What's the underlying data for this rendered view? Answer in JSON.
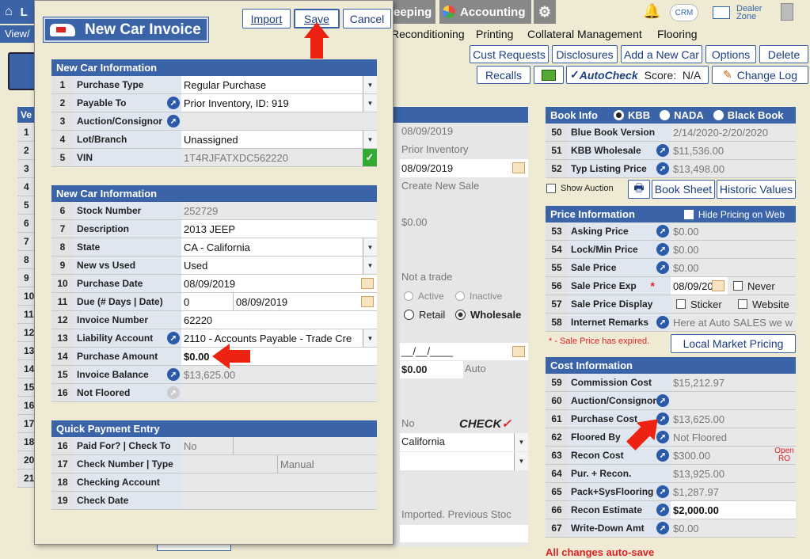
{
  "topbar": {
    "home": "L",
    "tab_keeping": "eeping",
    "tab_accounting": "Accounting",
    "crm": "CRM",
    "dealer_zone": "Dealer Zone",
    "view": "View/"
  },
  "menu": {
    "items": [
      "Reconditioning",
      "Printing",
      "Collateral Management",
      "Flooring"
    ]
  },
  "actions": {
    "row1": [
      "Cust Requests",
      "Disclosures",
      "Add a New Car",
      "Options",
      "Delete"
    ],
    "recalls": "Recalls",
    "autocheck": "AutoCheck",
    "score": "Score:  N/A",
    "change_log": "Change Log"
  },
  "dialog": {
    "title": "New Car Invoice",
    "import": "Import",
    "save": "Save",
    "cancel": "Cancel",
    "sec1": "New Car Information",
    "rows1": [
      {
        "n": "1",
        "label": "Purchase Type",
        "value": "Regular Purchase"
      },
      {
        "n": "2",
        "label": "Payable To",
        "value": "Prior Inventory,  ID: 919"
      },
      {
        "n": "3",
        "label": "Auction/Consignor",
        "value": ""
      },
      {
        "n": "4",
        "label": "Lot/Branch",
        "value": "Unassigned"
      },
      {
        "n": "5",
        "label": "VIN",
        "value": "1T4RJFATXDC562220"
      }
    ],
    "sec2": "New Car Information",
    "rows2": [
      {
        "n": "6",
        "label": "Stock Number",
        "value": "252729"
      },
      {
        "n": "7",
        "label": "Description",
        "value": "2013 JEEP"
      },
      {
        "n": "8",
        "label": "State",
        "value": "CA - California"
      },
      {
        "n": "9",
        "label": "New vs Used",
        "value": "Used"
      },
      {
        "n": "10",
        "label": "Purchase Date",
        "value": "08/09/2019"
      },
      {
        "n": "11",
        "label": "Due (# Days | Date)",
        "value": "0",
        "value2": "08/09/2019"
      },
      {
        "n": "12",
        "label": "Invoice Number",
        "value": "62220"
      },
      {
        "n": "13",
        "label": "Liability Account",
        "value": "2110 - Accounts Payable - Trade Cre"
      },
      {
        "n": "14",
        "label": "Purchase Amount",
        "value": "$0.00"
      },
      {
        "n": "15",
        "label": "Invoice Balance",
        "value": "$13,625.00"
      },
      {
        "n": "16",
        "label": "Not Floored",
        "value": ""
      }
    ],
    "sec3": "Quick Payment Entry",
    "rows3": [
      {
        "n": "16",
        "label": "Paid For? | Check To",
        "value": "No",
        "value2": ""
      },
      {
        "n": "17",
        "label": "Check Number | Type",
        "value": "",
        "value2": "Manual"
      },
      {
        "n": "18",
        "label": "Checking Account",
        "value": ""
      },
      {
        "n": "19",
        "label": "Check Date",
        "value": ""
      }
    ]
  },
  "middle": {
    "v1": "08/09/2019",
    "v2": "Prior Inventory",
    "v3": "08/09/2019",
    "v4": "Create New Sale",
    "v5": "$0.00",
    "v6": "Not a trade",
    "active": "Active",
    "inactive": "Inactive",
    "retail": "Retail",
    "wholesale": "Wholesale",
    "date_blank": "__/__/____",
    "v7": "$0.00",
    "v8": "Auto",
    "v9": "No",
    "check": "CHECK",
    "v10": "California",
    "v11": "Imported.  Previous Stoc",
    "left_nums": [
      "1",
      "2",
      "3",
      "4",
      "5",
      "6",
      "7",
      "8",
      "9",
      "10",
      "11",
      "12",
      "13",
      "14",
      "15",
      "16",
      "17",
      "18",
      "20",
      "21"
    ],
    "left_hdr": "Ve"
  },
  "book": {
    "title": "Book Info",
    "kbb": "KBB",
    "nada": "NADA",
    "black": "Black Book",
    "rows": [
      {
        "n": "50",
        "label": "Blue Book Version",
        "value": "2/14/2020-2/20/2020"
      },
      {
        "n": "51",
        "label": "KBB Wholesale",
        "value": "$11,536.00"
      },
      {
        "n": "52",
        "label": "Typ Listing Price",
        "value": "$13,498.00"
      }
    ],
    "show_auction": "Show Auction",
    "book_sheet": "Book Sheet",
    "historic": "Historic Values"
  },
  "price": {
    "title": "Price Information",
    "hide": "Hide Pricing on Web",
    "rows": [
      {
        "n": "53",
        "label": "Asking Price",
        "value": "$0.00"
      },
      {
        "n": "54",
        "label": "Lock/Min Price",
        "value": "$0.00"
      },
      {
        "n": "55",
        "label": "Sale Price",
        "value": "$0.00"
      },
      {
        "n": "56",
        "label": "Sale Price Exp",
        "value": "08/09/2019",
        "extra": "Never"
      },
      {
        "n": "57",
        "label": "Sale Price Display",
        "value": "Sticker",
        "extra": "Website"
      },
      {
        "n": "58",
        "label": "Internet Remarks",
        "value": "Here at Auto SALES we w"
      }
    ],
    "expired": "* - Sale Price has expired.",
    "local": "Local Market Pricing"
  },
  "cost": {
    "title": "Cost Information",
    "rows": [
      {
        "n": "59",
        "label": "Commission Cost",
        "value": "$15,212.97"
      },
      {
        "n": "60",
        "label": "Auction/Consignor",
        "value": ""
      },
      {
        "n": "61",
        "label": "Purchase Cost",
        "value": "$13,625.00"
      },
      {
        "n": "62",
        "label": "Floored By",
        "value": "Not Floored"
      },
      {
        "n": "63",
        "label": "Recon Cost",
        "value": "$300.00",
        "extra": "Open RO"
      },
      {
        "n": "64",
        "label": "Pur. + Recon.",
        "value": "$13,925.00"
      },
      {
        "n": "65",
        "label": "Pack+SysFlooring",
        "value": "$1,287.97"
      },
      {
        "n": "66",
        "label": "Recon Estimate",
        "value": "$2,000.00"
      },
      {
        "n": "67",
        "label": "Write-Down Amt",
        "value": "$0.00"
      }
    ],
    "autosave": "All changes auto-save"
  }
}
